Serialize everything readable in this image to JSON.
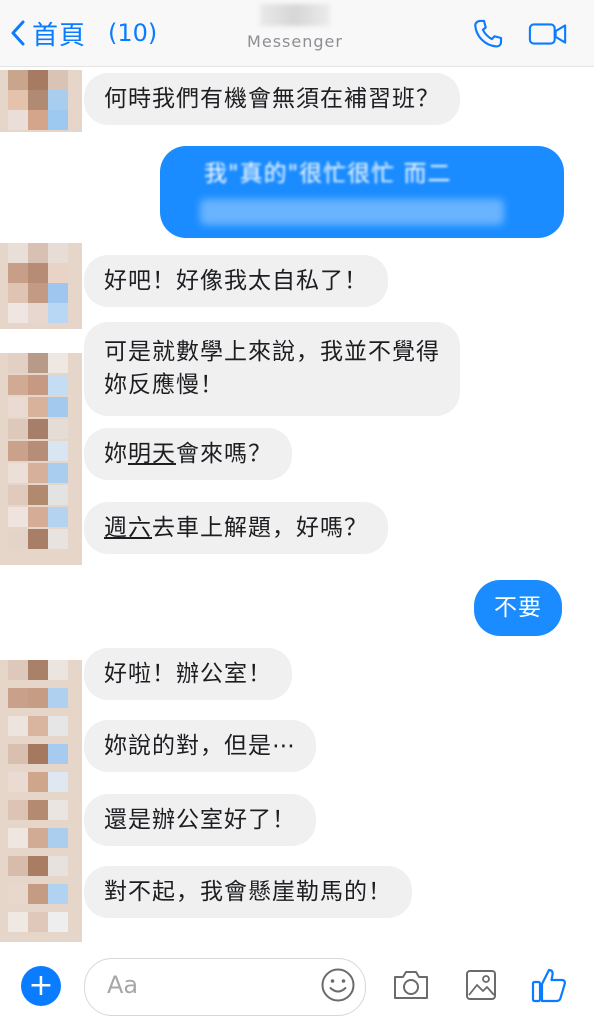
{
  "header": {
    "back_label": "首頁",
    "unread_count": "(10)",
    "subtitle": "Messenger",
    "icons": {
      "back": "chevron-left-icon",
      "call": "phone-icon",
      "video": "video-camera-icon"
    },
    "accent_color": "#0a7cff"
  },
  "messages": [
    {
      "from": "them",
      "text": "何時我們有機會無須在補習班？"
    },
    {
      "from": "me",
      "text": "我\"真的\"很忙很忙 而二",
      "blurred": true
    },
    {
      "from": "them",
      "text": "好吧！好像我太自私了！"
    },
    {
      "from": "them",
      "line1": "可是就數學上來說，我並不覺得",
      "line2": "妳反應慢！"
    },
    {
      "from": "them",
      "pre": "妳",
      "underlined": "明天",
      "post": "會來嗎？"
    },
    {
      "from": "them",
      "underlined": "週六",
      "post": "去車上解題，好嗎？"
    },
    {
      "from": "me",
      "text": "不要"
    },
    {
      "from": "them",
      "text": "好啦！辦公室！"
    },
    {
      "from": "them",
      "text": "妳說的對，但是⋯"
    },
    {
      "from": "them",
      "text": "還是辦公室好了！"
    },
    {
      "from": "them",
      "text": "對不起，我會懸崖勒馬的！"
    }
  ],
  "composer": {
    "placeholder": "Aa",
    "plus_symbol": "+",
    "icons": {
      "plus": "plus-circle-icon",
      "emoji": "smiley-icon",
      "camera": "camera-icon",
      "gallery": "photo-icon",
      "like": "thumbs-up-icon"
    }
  },
  "colors": {
    "incoming_bubble": "#f1f0f0",
    "outgoing_bubble": "#1a8cff"
  }
}
